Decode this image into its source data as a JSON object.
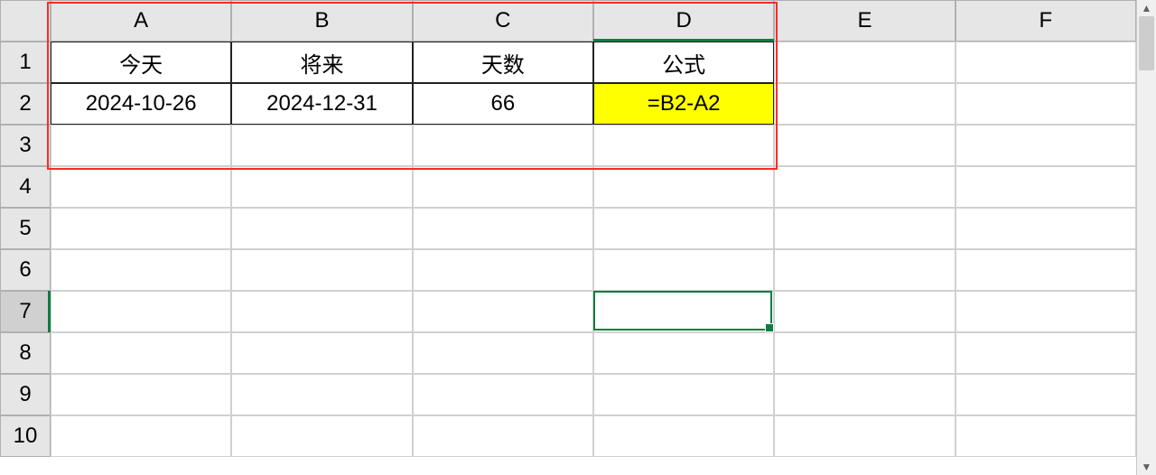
{
  "columns": [
    "A",
    "B",
    "C",
    "D",
    "E",
    "F"
  ],
  "rows": [
    "1",
    "2",
    "3",
    "4",
    "5",
    "6",
    "7",
    "8",
    "9",
    "10"
  ],
  "cells": {
    "A1": "今天",
    "B1": "将来",
    "C1": "天数",
    "D1": "公式",
    "A2": "2024-10-26",
    "B2": "2024-12-31",
    "C2": "66",
    "D2": "=B2-A2"
  },
  "highlighted_cell": "D2",
  "active_cell": "D7",
  "selected_row_header": "7",
  "selected_col_header": "D",
  "annotation_range": "A1:D3",
  "data_border_range": "A1:D2",
  "colors": {
    "highlight": "#ffff00",
    "selection": "#107c41",
    "annotation": "#ff2a2a"
  }
}
